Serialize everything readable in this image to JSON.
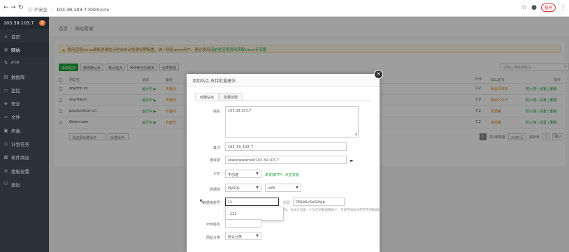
{
  "browser": {
    "url_security": "不安全",
    "url_host": "103.39.103.7",
    "url_path": ":8889/site",
    "pause_label": "暂停"
  },
  "sidebar": {
    "server_ip": "103.39.103.7",
    "badge": "0",
    "items": [
      {
        "icon": "home",
        "label": "首页"
      },
      {
        "icon": "globe",
        "label": "网站"
      },
      {
        "icon": "ftp",
        "label": "FTP"
      },
      {
        "icon": "database",
        "label": "数据库"
      },
      {
        "icon": "monitor",
        "label": "监控"
      },
      {
        "icon": "shield",
        "label": "安全"
      },
      {
        "icon": "folder",
        "label": "文件"
      },
      {
        "icon": "terminal",
        "label": "终端"
      },
      {
        "icon": "clock",
        "label": "计划任务"
      },
      {
        "icon": "store",
        "label": "软件商店"
      },
      {
        "icon": "gear",
        "label": "面板设置"
      },
      {
        "icon": "logout",
        "label": "退出"
      }
    ]
  },
  "breadcrumb": {
    "home": "首页",
    "current": "网站管理"
  },
  "notice": {
    "text": "使用宝塔Linux面板创建站点时会自动创建权限配置，统一使用www用户。建议使用",
    "link": "请前往宝塔官网获取Linux专享版"
  },
  "toolbar": {
    "add": "添加站点",
    "default_page": "修改默认页",
    "default_site": "默认站点",
    "php_cli": "PHP命令行版本",
    "category": "分类管理"
  },
  "search_placeholder": "请输入域名或备注",
  "table": {
    "headers": {
      "name": "网站名",
      "status": "状态",
      "backup": "备份",
      "php": "PHP",
      "ssl": "SSL证书",
      "ops": "操作"
    },
    "rows": [
      {
        "name": "ooyrmn.cn",
        "status": "运行中 ▶",
        "backup": "无备份",
        "php": "7.2",
        "ssl": "剩余293天",
        "ops": "防火墙 | 设置 | 删除"
      },
      {
        "name": "ooyrnw.cn",
        "status": "运行中 ▶",
        "backup": "有备份",
        "php": "7.2",
        "ssl": "剩余223天",
        "ops": "防火墙 | 设置 | 删除"
      },
      {
        "name": "pay.qunmixn.cn",
        "status": "运行中 ▶",
        "backup": "有备份",
        "php": "7.2",
        "ssl": "未部署",
        "ops": "防火墙 | 设置 | 删除"
      },
      {
        "name": "Ooym.com",
        "status": "运行中 ▶",
        "backup": "有备份",
        "php": "7.2",
        "ssl": "未部署",
        "ops": "防火墙 | 设置 | 删除"
      }
    ]
  },
  "bottom": {
    "batch_select": "请选择批量操作",
    "batch_btn": "批量操作",
    "page": "1",
    "total": "共4条数据",
    "per_page": "20条/页",
    "goto_label": "跳转到",
    "goto_value": "1",
    "confirm": "确认"
  },
  "modal": {
    "title": "添加站点-支持批量建站",
    "tab_create": "创建站点",
    "tab_batch": "批量创建",
    "domain_label": "域名",
    "domain_value": "103.39.103.7",
    "remark_label": "备注",
    "remark_value": "103_39_103_7",
    "root_label": "根目录",
    "root_value": "/www/wwwroot/103.39.103.7",
    "ftp_label": "FTP",
    "ftp_value": "不创建",
    "ftp_hint": "未安装FTP，点击安装",
    "db_label": "数据库",
    "db_type": "MySQL",
    "db_charset": "utf8",
    "db_user_label": "数据库账号",
    "db_user_value": "11",
    "db_pass_label": "密码",
    "db_pass_value": "DNLb5xSwS2tpp",
    "db_hint": "创建站点的同时，为站点创建一个对应的数据库帐户，方便不同站点使用不同数据库。",
    "dropdown_item": "111",
    "php_label": "PHP版本",
    "category_label": "网站分类",
    "category_value": "默认分类"
  }
}
